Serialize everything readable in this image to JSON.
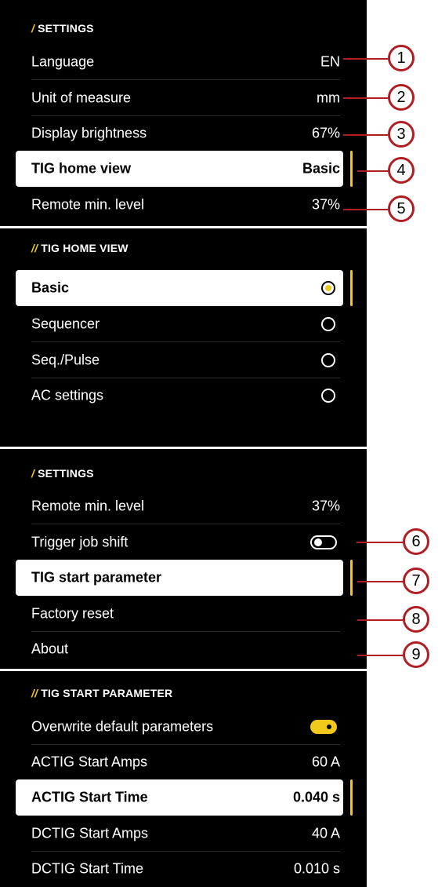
{
  "settings1": {
    "header_slash": "/",
    "header": "SETTINGS",
    "rows": [
      {
        "label": "Language",
        "value": "EN"
      },
      {
        "label": "Unit of measure",
        "value": "mm"
      },
      {
        "label": "Display brightness",
        "value": "67%"
      },
      {
        "label": "TIG home view",
        "value": "Basic"
      },
      {
        "label": "Remote min. level",
        "value": "37%"
      }
    ]
  },
  "home_view": {
    "header_slash": "//",
    "header": "TIG HOME VIEW",
    "options": [
      {
        "label": "Basic",
        "selected": true
      },
      {
        "label": "Sequencer",
        "selected": false
      },
      {
        "label": "Seq./Pulse",
        "selected": false
      },
      {
        "label": "AC settings",
        "selected": false
      }
    ]
  },
  "settings2": {
    "header_slash": "/",
    "header": "SETTINGS",
    "rows": [
      {
        "label": "Remote min. level",
        "value": "37%"
      },
      {
        "label": "Trigger job shift",
        "toggle": "off"
      },
      {
        "label": "TIG start parameter",
        "value": ""
      },
      {
        "label": "Factory reset",
        "value": ""
      },
      {
        "label": "About",
        "value": ""
      }
    ]
  },
  "start_param": {
    "header_slash": "//",
    "header": "TIG START PARAMETER",
    "rows": [
      {
        "label": "Overwrite default parameters",
        "toggle": "on"
      },
      {
        "label": "ACTIG Start Amps",
        "value": "60 A"
      },
      {
        "label": "ACTIG Start Time",
        "value": "0.040 s"
      },
      {
        "label": "DCTIG Start Amps",
        "value": "40 A"
      },
      {
        "label": "DCTIG Start Time",
        "value": "0.010 s"
      }
    ]
  },
  "callouts": [
    "1",
    "2",
    "3",
    "4",
    "5",
    "6",
    "7",
    "8",
    "9"
  ],
  "colors": {
    "accent": "#f2c81b",
    "callout": "#b01e23",
    "panel": "#000000"
  }
}
